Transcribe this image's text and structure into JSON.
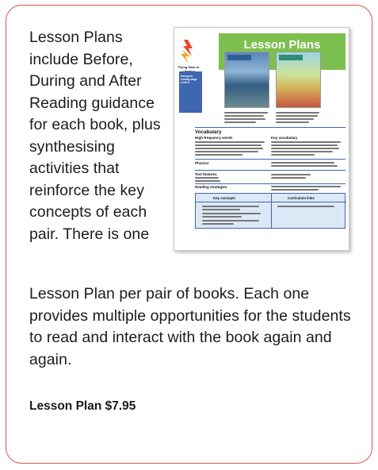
{
  "text": {
    "intro": "Lesson Plans include Before, During and After Reading guidance for each book, plus synthesising activities that reinforce the key concepts of each pair. There is one",
    "continuation": "Lesson Plan per pair of books. Each one provides multiple opportunities for the students to read and interact with the book again and again.",
    "price": "Lesson Plan $7.95"
  },
  "thumbnail": {
    "title": "Lesson Plans",
    "logo_text": "Flying Start to Literacy",
    "side_label": "Emergent reading stage Level 6",
    "vocabulary": "Vocabulary",
    "high_frequency": "High-frequency words",
    "key_vocabulary": "Key vocabulary",
    "phonics": "Phonics",
    "text_features": "Text features",
    "reading_strategies": "Reading strategies",
    "key_concepts": "Key concepts",
    "curriculum_links": "Curriculum links"
  },
  "colors": {
    "card_border": "#d9534f",
    "header_green": "#7dbf4e",
    "accent_blue": "#3f66b0",
    "box_fill": "#dce8f6"
  }
}
